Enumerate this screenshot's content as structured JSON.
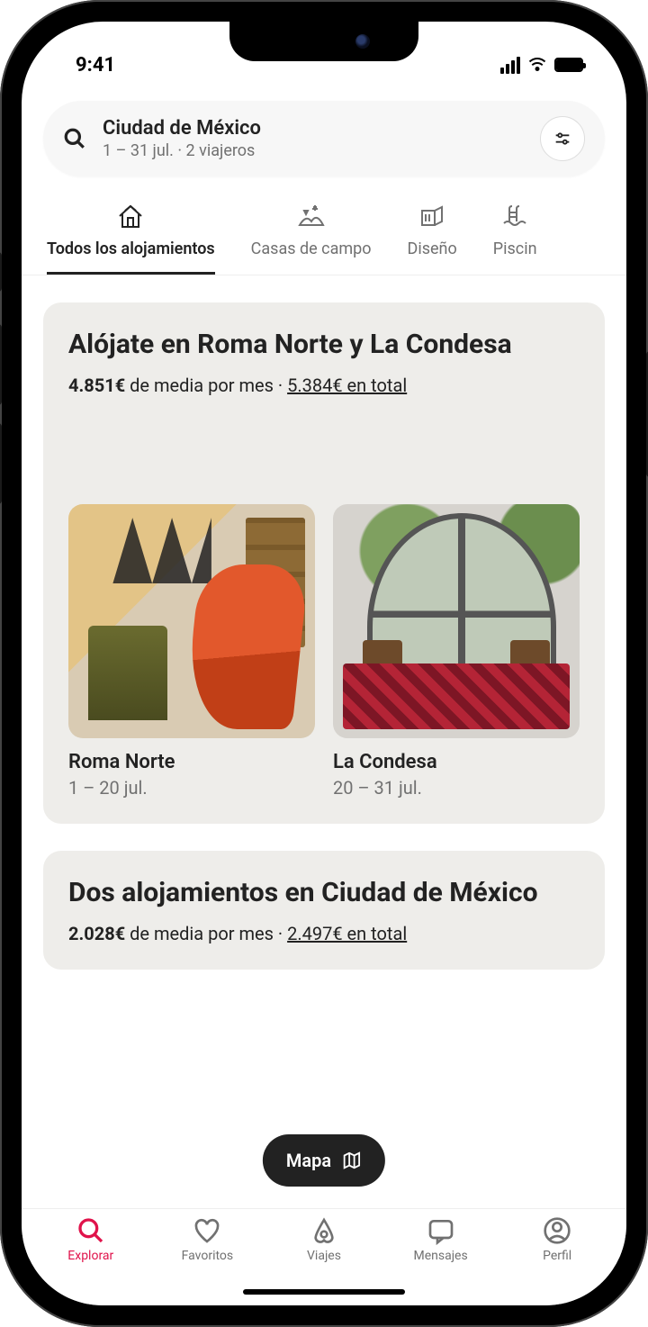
{
  "status": {
    "time": "9:41"
  },
  "search": {
    "location": "Ciudad de México",
    "subtitle": "1 – 31 jul. · 2 viajeros"
  },
  "categories": [
    {
      "label": "Todos los alojamientos",
      "active": true
    },
    {
      "label": "Casas de campo",
      "active": false
    },
    {
      "label": "Diseño",
      "active": false
    },
    {
      "label": "Piscin",
      "active": false
    }
  ],
  "cards": [
    {
      "title": "Alójate en Roma Norte y La Condesa",
      "avg_price": "4.851€",
      "avg_suffix": " de media por mes · ",
      "total_price": "5.384€ en total",
      "listings": [
        {
          "name": "Roma Norte",
          "dates": "1 – 20 jul."
        },
        {
          "name": "La Condesa",
          "dates": "20 – 31 jul."
        }
      ]
    },
    {
      "title": "Dos alojamientos en Ciudad de México",
      "avg_price": "2.028€",
      "avg_suffix": " de media por mes · ",
      "total_price": "2.497€ en total"
    }
  ],
  "map_button": "Mapa",
  "nav": [
    {
      "label": "Explorar"
    },
    {
      "label": "Favoritos"
    },
    {
      "label": "Viajes"
    },
    {
      "label": "Mensajes"
    },
    {
      "label": "Perfil"
    }
  ]
}
